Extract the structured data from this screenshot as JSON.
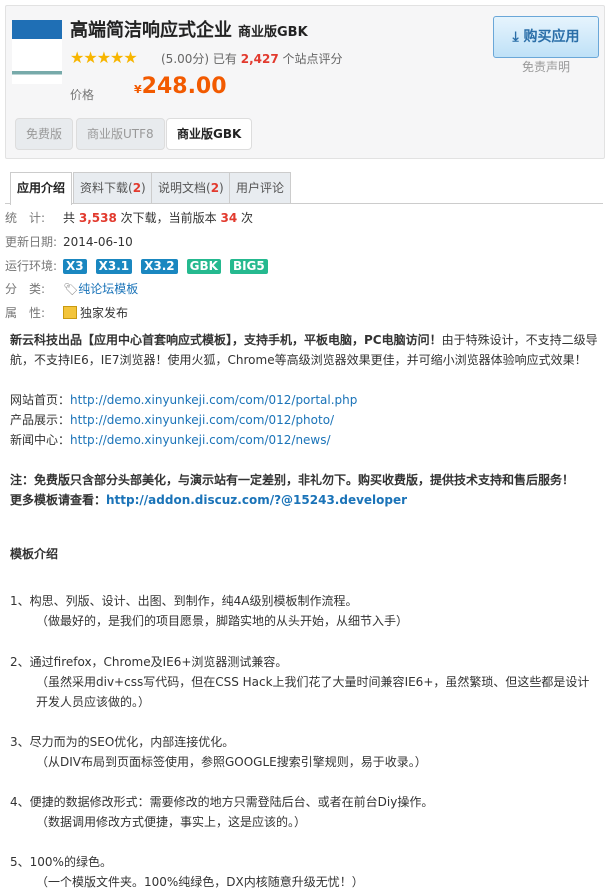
{
  "header": {
    "title": "高端简洁响应式企业",
    "edition": "商业版GBK",
    "stars": "★★★★★",
    "rating": "(5.00分) 已有",
    "rating_count": "2,427",
    "rating_suffix": "个站点评分",
    "price_label": "价格",
    "currency": "¥",
    "price": "248.00",
    "versions": [
      "免费版",
      "商业版UTF8",
      "商业版GBK"
    ],
    "buy_label": "购买应用",
    "disclaimer": "免责声明"
  },
  "tabs": [
    {
      "label": "应用介绍"
    },
    {
      "label": "资料下载(",
      "count": "2"
    },
    {
      "label": "说明文档(",
      "count": "2"
    },
    {
      "label": "用户评论"
    }
  ],
  "info": {
    "stats_label": "统　计:",
    "stats_pre": "共",
    "downloads": "3,538",
    "stats_mid": "次下载，当前版本",
    "version_downloads": "34",
    "stats_end": "次",
    "date_label": "更新日期:",
    "date": "2014-06-10",
    "env_label": "运行环境:",
    "env": [
      "X3",
      "X3.1",
      "X3.2",
      "GBK",
      "BIG5"
    ],
    "cat_label": "分　类:",
    "category": "纯论坛模板",
    "attr_label": "属　性:",
    "attr": "独家发布"
  },
  "desc": {
    "bold": "新云科技出品【应用中心首套响应式模板】，支持手机，平板电脑，PC电脑访问！",
    "rest": "由于特殊设计，不支持二级导航，不支持IE6，IE7浏览器！使用火狐，Chrome等高级浏览器效果更佳，并可缩小浏览器体验响应式效果！"
  },
  "links": [
    {
      "label": "网站首页：",
      "url": "http://demo.xinyunkeji.com/com/012/portal.php"
    },
    {
      "label": "产品展示：",
      "url": "http://demo.xinyunkeji.com/com/012/photo/"
    },
    {
      "label": "新闻中心：",
      "url": "http://demo.xinyunkeji.com/com/012/news/"
    }
  ],
  "note": "注：免费版只含部分头部美化，与演示站有一定差别，非礼勿下。购买收费版，提供技术支持和售后服务！",
  "more_label": "更多模板请查看：",
  "more_url": "http://addon.discuz.com/?@15243.developer",
  "intro_title": "模板介绍",
  "items": [
    {
      "t": "1、构思、列版、设计、出图、到制作，纯4A级别模板制作流程。",
      "s": "（做最好的，是我们的项目愿景，脚踏实地的从头开始，从细节入手）"
    },
    {
      "t": "2、通过firefox，Chrome及IE6+浏览器测试兼容。",
      "s": "（虽然采用div+css写代码，但在CSS Hack上我们花了大量时间兼容IE6+，虽然繁琐、但这些都是设计开发人员应该做的。）"
    },
    {
      "t": "3、尽力而为的SEO优化，内部连接优化。",
      "s": "（从DIV布局到页面标签使用，参照GOOGLE搜索引擎规则，易于收录。）"
    },
    {
      "t": "4、便捷的数据修改形式：需要修改的地方只需登陆后台、或者在前台Diy操作。",
      "s": "（数据调用修改方式便捷，事实上，这是应该的。）"
    },
    {
      "t": "5、100%的绿色。",
      "s": "（一个模版文件夹。100%纯绿色，DX内核随意升级无忧！）"
    }
  ]
}
